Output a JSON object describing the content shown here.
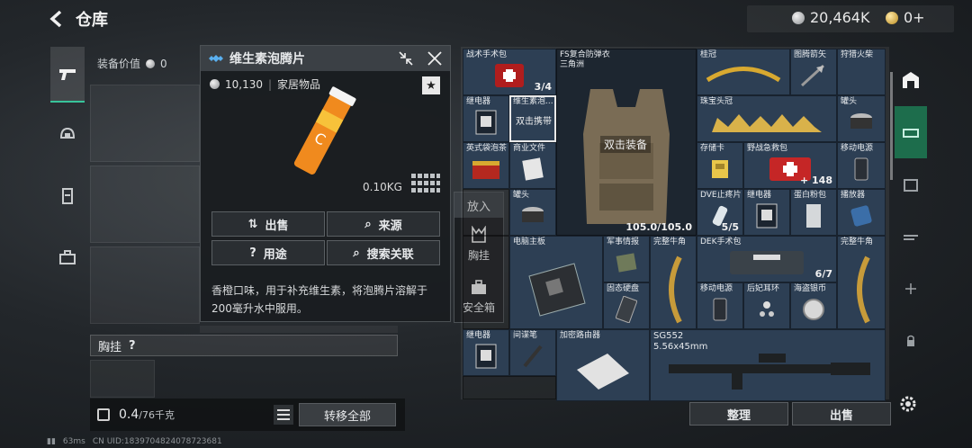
{
  "header": {
    "title": "仓库",
    "currency_silver": "20,464K",
    "currency_gold": "0+"
  },
  "left": {
    "equip_value_label": "装备价值",
    "equip_value": "0",
    "chest_label": "胸挂",
    "weight": "0.4",
    "weight_max": "/76千克",
    "transfer_all": "转移全部"
  },
  "popup": {
    "title": "维生素泡腾片",
    "price": "10,130",
    "category": "家居物品",
    "weight": "0.10KG",
    "sell": "出售",
    "source": "来源",
    "usage": "用途",
    "search_related": "搜索关联",
    "description": "香橙口味，用于补充维生素，将泡腾片溶解于200毫升水中服用。"
  },
  "putin": {
    "title": "放入",
    "opt1": "胸挂",
    "opt2": "安全箱"
  },
  "inventory": {
    "cells": [
      {
        "name": "战术手术包",
        "count": "3/4"
      },
      {
        "name": "FS复合防弹衣\n三角洲",
        "count": "105.0/105.0",
        "action": "双击装备"
      },
      {
        "name": "桂冠"
      },
      {
        "name": "图腾箭矢"
      },
      {
        "name": "狩猎火柴"
      },
      {
        "name": "继电器"
      },
      {
        "name": "维生素泡...",
        "action": "双击携带"
      },
      {
        "name": "珠宝头冠"
      },
      {
        "name": "罐头"
      },
      {
        "name": "英式袋泡茶"
      },
      {
        "name": "商业文件"
      },
      {
        "name": "存储卡"
      },
      {
        "name": "野战急救包",
        "count": "148"
      },
      {
        "name": "移动电源"
      },
      {
        "name": "罐头"
      },
      {
        "name": "DVE止疼片",
        "count": "5/5"
      },
      {
        "name": "继电器"
      },
      {
        "name": "蛋白粉包"
      },
      {
        "name": "播放器"
      },
      {
        "name": "电脑主板"
      },
      {
        "name": "军事情报"
      },
      {
        "name": "完整牛角"
      },
      {
        "name": "DEK手术包",
        "count": "6/7"
      },
      {
        "name": "完整牛角"
      },
      {
        "name": "固态硬盘"
      },
      {
        "name": "移动电源"
      },
      {
        "name": "后妃耳环"
      },
      {
        "name": "海盗银币"
      },
      {
        "name": "继电器"
      },
      {
        "name": "间谍笔"
      },
      {
        "name": "加密路由器"
      },
      {
        "name": "SG552\n5.56x45mm"
      }
    ]
  },
  "bottom": {
    "sort": "整理",
    "sell": "出售"
  },
  "footer": {
    "ping": "63ms",
    "uid": "CN UID:1839704824078723681"
  }
}
